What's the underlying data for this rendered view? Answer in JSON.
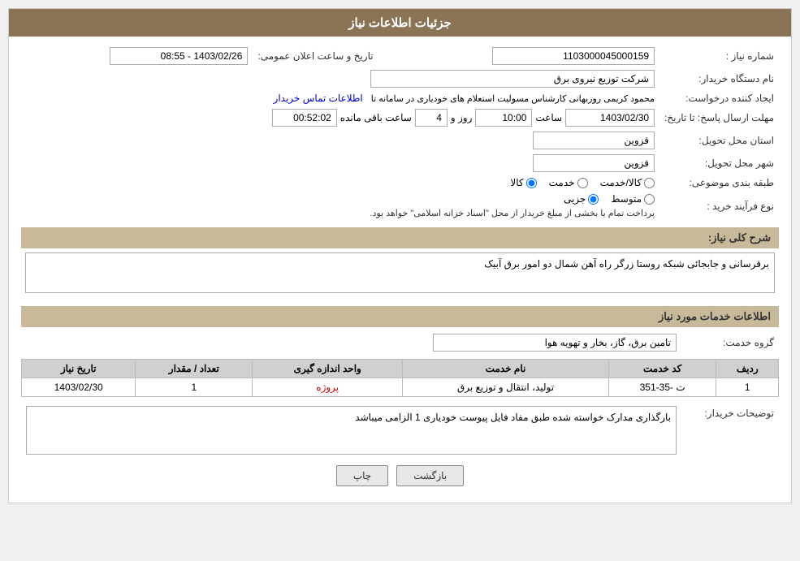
{
  "header": {
    "title": "جزئیات اطلاعات نیاز"
  },
  "fields": {
    "shomara_niaz_label": "شماره نیاز :",
    "shomara_niaz_value": "1103000045000159",
    "nam_dastgah_label": "نام دستگاه خریدار:",
    "nam_dastgah_value": "شرکت توزیع نیروی برق",
    "ijad_konande_label": "ایجاد کننده درخواست:",
    "ijad_konande_value": "محمود کریمی روزبهانی کارشناس  مسولیت استعلام های خودیاری در سامانه تا",
    "contact_link": "اطلاعات تماس خریدار",
    "mohlat_label": "مهلت ارسال پاسخ: تا تاریخ:",
    "date_value": "1403/02/30",
    "time_label": "ساعت",
    "time_value": "10:00",
    "days_label": "روز و",
    "days_value": "4",
    "remaining_label": "ساعت باقی مانده",
    "remaining_value": "00:52:02",
    "ostan_label": "استان محل تحویل:",
    "ostan_value": "قزوین",
    "shahr_label": "شهر محل تحویل:",
    "shahr_value": "قزوین",
    "tabaqa_label": "طبقه بندی موضوعی:",
    "tabaqa_value": "",
    "nooe_farayand_label": "نوع فرآیند خرید :",
    "radio_kala": "کالا",
    "radio_khadamat": "خدمت",
    "radio_kala_khadamat": "کالا/خدمت",
    "radio_jozii": "جزیی",
    "radio_mootasat": "متوسط",
    "nooe_farayand_text": "پرداخت تمام یا بخشی از مبلغ خریدار از محل \"اسناد خزانه اسلامی\" خواهد بود.",
    "sharh_label": "شرح کلی نیاز:",
    "sharh_value": "برقرسانی و جابجائی شبکه روستا زرگر راه آهن شمال دو امور برق آبیک",
    "khadamat_label": "اطلاعات خدمات مورد نیاز",
    "grooh_khadamat_label": "گروه خدمت:",
    "grooh_khadamat_value": "تامین برق، گاز، بخار و تهویه هوا",
    "table": {
      "headers": [
        "ردیف",
        "کد خدمت",
        "نام خدمت",
        "واحد اندازه گیری",
        "تعداد / مقدار",
        "تاریخ نیاز"
      ],
      "rows": [
        {
          "radif": "1",
          "kod": "ت -35-351",
          "nam": "تولید، انتقال و توزیع برق",
          "vahed": "پروژه",
          "tedad": "1",
          "tarikh": "1403/02/30"
        }
      ]
    },
    "tozihat_label": "توضیحات خریدار:",
    "tozihat_value": "بارگذاری مدارک خواسته شده طبق مفاد فایل پیوست خودیاری 1 الزامی میباشد"
  },
  "buttons": {
    "print": "چاپ",
    "back": "بازگشت"
  },
  "tarikh_aalan_label": "تاریخ و ساعت اعلان عمومی:",
  "tarikh_aalan_value": "1403/02/26 - 08:55"
}
